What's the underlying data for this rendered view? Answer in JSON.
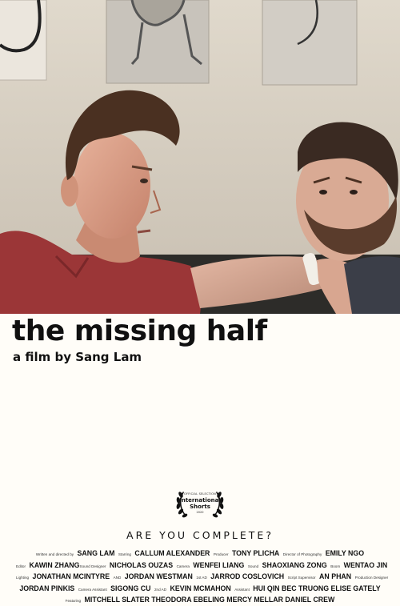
{
  "title": "the missing half",
  "byline": "a film by Sang Lam",
  "laurel": {
    "line1": "OFFICIAL SELECTION",
    "line2": "International",
    "line3": "Shorts",
    "line4": "2020"
  },
  "tagline": "ARE YOU COMPLETE?",
  "credits": {
    "r1": {
      "role1": "Written and directed by",
      "name1": "SANG LAM",
      "role2": "Starring",
      "name2": "CALLUM ALEXANDER",
      "role3": "Producer",
      "name3": "TONY PLICHA",
      "role4": "Director of Photography",
      "name4": "EMILY NGO"
    },
    "r2": {
      "role1": "Editor",
      "name1": "KAWIN ZHANG",
      "role2": "Sound Designer",
      "name2": "NICHOLAS OUZAS",
      "role3": "Camera",
      "name3": "WENFEI LIANG",
      "role4": "Sound",
      "name4": "SHAOXIANG ZONG",
      "role5": "Boom",
      "name5": "WENTAO JIN"
    },
    "r3": {
      "role1": "Lighting",
      "name1": "JONATHAN MCINTYRE",
      "and": "AND",
      "name2": "JORDAN WESTMAN",
      "role3": "1st AD",
      "name3": "JARROD COSLOVICH",
      "role4": "Script Supervisor",
      "name4": "AN PHAN",
      "role5": "Production Designer"
    },
    "r4": {
      "name1": "JORDAN PINKIS",
      "role2": "Camera Assistant",
      "name2": "SIGONG CU",
      "role3": "2nd AD",
      "name3": "KEVIN MCMAHON",
      "role4": "Assistant",
      "name4": "HUI QIN BEC TRUONG ELISE GATELY"
    },
    "r5": {
      "role1": "Featuring",
      "name1": "MITCHELL SLATER THEODORA EBELING MERCY MELLAR DANIEL CREW"
    }
  }
}
